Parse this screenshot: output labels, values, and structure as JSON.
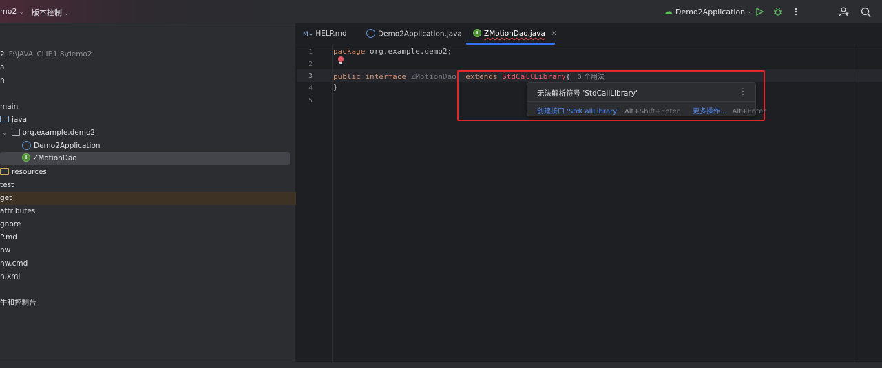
{
  "titlebar": {
    "project": "mo2",
    "vcs": "版本控制",
    "run_config": "Demo2Application",
    "icons": [
      "run-icon",
      "debug-icon",
      "more-icon",
      "add-user-icon",
      "search-icon"
    ]
  },
  "project_tree": {
    "root_name": "2",
    "root_path": "F:\\JAVA_CLIB1.8\\demo2",
    "rows": [
      "a",
      "n",
      "main",
      "java",
      "org.example.demo2",
      "Demo2Application",
      "ZMotionDao",
      "resources",
      "test",
      "get",
      "attributes",
      "gnore",
      "P.md",
      "nw",
      "nw.cmd",
      "n.xml",
      "牛和控制台"
    ]
  },
  "tabs": [
    {
      "label": "HELP.md",
      "icon": "markdown-icon",
      "prefix": "M↓"
    },
    {
      "label": "Demo2Application.java",
      "icon": "class-icon"
    },
    {
      "label": "ZMotionDao.java",
      "icon": "interface-icon",
      "active": true
    }
  ],
  "editor": {
    "line_numbers": [
      "1",
      "2",
      "3",
      "4",
      "5"
    ],
    "line1": {
      "kw": "package",
      "rest": " org.example.demo2;"
    },
    "line3": {
      "kw1": "public",
      "kw2": "interface",
      "name": "ZMotionDao",
      "kw3": "extends",
      "error_symbol": "StdCallLibrary",
      "brace": "{",
      "inlay": "0 个用法"
    },
    "line4": "}"
  },
  "popup": {
    "title": "无法解析符号 'StdCallLibrary'",
    "create_label": "创建接口 'StdCallLibrary'",
    "create_shortcut": "Alt+Shift+Enter",
    "more_label": "更多操作...",
    "more_shortcut": "Alt+Enter"
  },
  "colors": {
    "accent": "#3574f0",
    "error_highlight": "#e2262d",
    "keyword": "#cf8e6d"
  }
}
